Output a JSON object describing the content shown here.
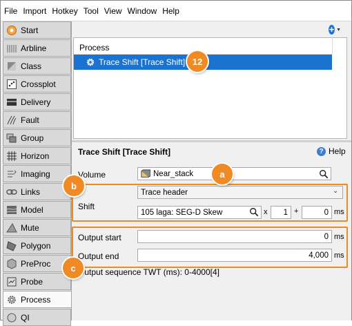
{
  "menu": [
    "File",
    "Import",
    "Hotkey",
    "Tool",
    "View",
    "Window",
    "Help"
  ],
  "sidebar": {
    "items": [
      {
        "label": "Start",
        "icon": "start-icon"
      },
      {
        "label": "Arbline",
        "icon": "arbline-icon"
      },
      {
        "label": "Class",
        "icon": "class-icon"
      },
      {
        "label": "Crossplot",
        "icon": "crossplot-icon"
      },
      {
        "label": "Delivery",
        "icon": "delivery-icon"
      },
      {
        "label": "Fault",
        "icon": "fault-icon"
      },
      {
        "label": "Group",
        "icon": "group-icon"
      },
      {
        "label": "Horizon",
        "icon": "horizon-icon"
      },
      {
        "label": "Imaging",
        "icon": "imaging-icon"
      },
      {
        "label": "Links",
        "icon": "links-icon"
      },
      {
        "label": "Model",
        "icon": "model-icon"
      },
      {
        "label": "Mute",
        "icon": "mute-icon"
      },
      {
        "label": "Polygon",
        "icon": "polygon-icon"
      },
      {
        "label": "PreProc",
        "icon": "preproc-icon"
      },
      {
        "label": "Probe",
        "icon": "probe-icon"
      },
      {
        "label": "Process",
        "icon": "process-icon",
        "active": true
      },
      {
        "label": "QI",
        "icon": "qi-icon"
      }
    ]
  },
  "process_list": {
    "header": "Process",
    "selected_item": "Trace Shift [Trace Shift]"
  },
  "params": {
    "title": "Trace Shift [Trace Shift]",
    "help_label": "Help",
    "volume_label": "Volume",
    "volume_value": "Near_stack",
    "shift_label": "Shift",
    "shift_mode": "Trace header",
    "shift_header": "105 laga: SEG-D Skew",
    "multiply_sign": "x",
    "multiplier": "1",
    "plus_sign": "+",
    "offset": "0",
    "offset_unit": "ms",
    "output_start_label": "Output start",
    "output_start_value": "0",
    "output_start_unit": "ms",
    "output_end_label": "Output end",
    "output_end_value": "4,000",
    "output_end_unit": "ms",
    "output_sequence": "Output sequence  TWT (ms): 0-4000[4]"
  },
  "callouts": {
    "process_badge": "12",
    "volume_badge": "a",
    "shift_badge": "b",
    "output_badge": "c"
  },
  "colors": {
    "accent": "#ef8a24",
    "selection": "#1a73d1",
    "info_blue": "#1e73d6"
  }
}
